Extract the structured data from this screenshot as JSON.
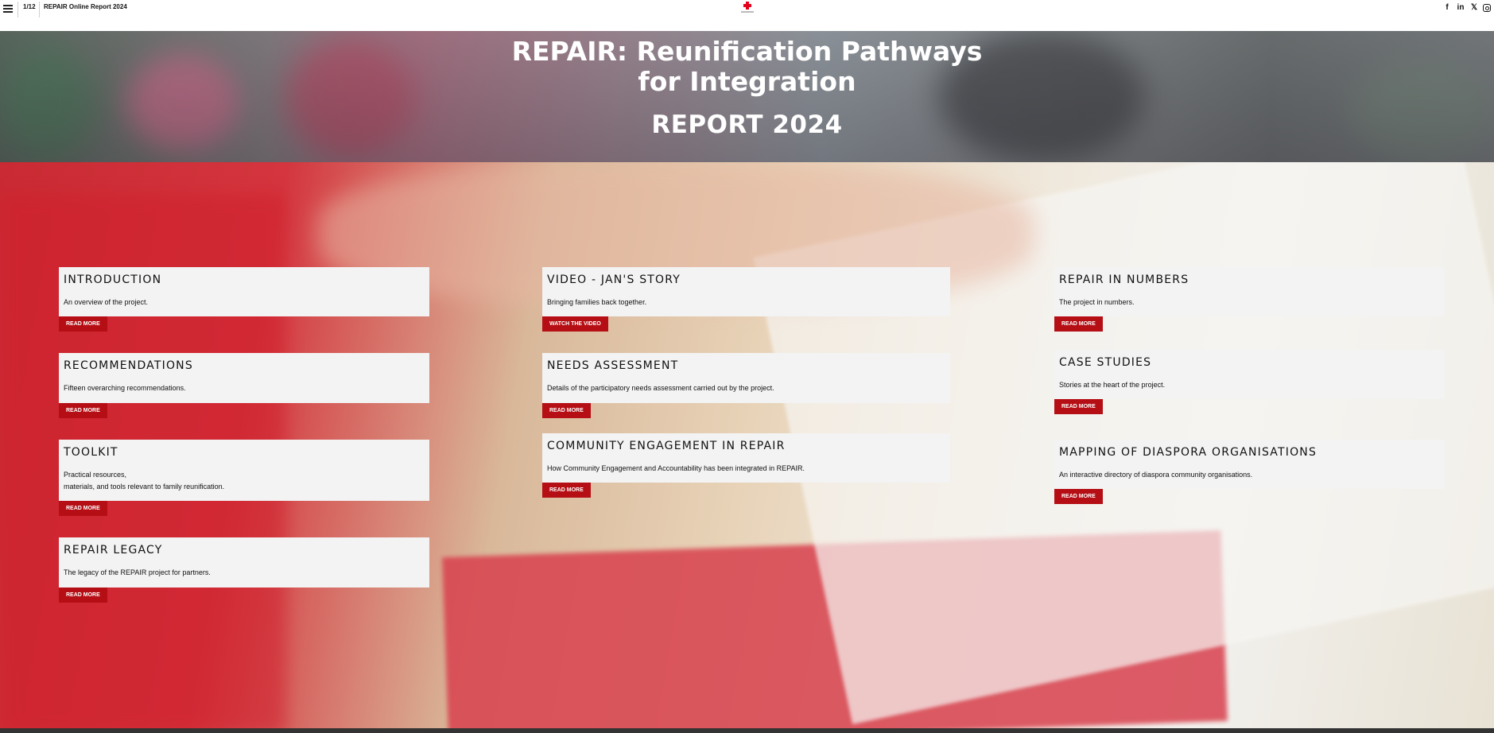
{
  "header": {
    "page_count": "1/12",
    "site_title": "REPAIR Online Report 2024",
    "social": [
      {
        "icon": "facebook-icon",
        "glyph": "f"
      },
      {
        "icon": "linkedin-icon",
        "glyph": "in"
      },
      {
        "icon": "x-icon",
        "glyph": "𝕏"
      },
      {
        "icon": "instagram-icon",
        "glyph": ""
      }
    ]
  },
  "hero": {
    "title_line1": "REPAIR: Reunification Pathways",
    "title_line2": "for Integration",
    "subtitle": "REPORT  2024"
  },
  "cards": {
    "introduction": {
      "title": "INTRODUCTION",
      "desc": "An overview of the project.",
      "button": "READ MORE"
    },
    "recommendations": {
      "title": "RECOMMENDATIONS",
      "desc": "Fifteen overarching recommendations.",
      "button": "READ MORE"
    },
    "toolkit": {
      "title": "TOOLKIT",
      "desc_line1": "Practical resources,",
      "desc_line2": "materials, and tools relevant to family reunification.",
      "button": "READ MORE"
    },
    "legacy": {
      "title": "REPAIR LEGACY",
      "desc": "The legacy of the REPAIR project for partners.",
      "button": "READ MORE"
    },
    "video": {
      "title": "VIDEO - JAN'S STORY",
      "desc": "Bringing families back together.",
      "button": "WATCH THE VIDEO"
    },
    "needs": {
      "title": "NEEDS ASSESSMENT",
      "desc": "Details of the participatory needs assessment carried out by the project.",
      "button": "READ MORE"
    },
    "community": {
      "title": "COMMUNITY ENGAGEMENT IN REPAIR",
      "desc": "How Community Engagement and Accountability has been integrated in REPAIR.",
      "button": "READ MORE"
    },
    "numbers": {
      "title": "REPAIR IN NUMBERS",
      "desc": "The project in numbers.",
      "button": "READ MORE"
    },
    "cases": {
      "title": "CASE STUDIES",
      "desc": "Stories at the heart of the project.",
      "button": "READ MORE"
    },
    "diaspora": {
      "title": "MAPPING OF DIASPORA ORGANISATIONS",
      "desc": "An interactive directory of diaspora community organisations.",
      "button": "READ MORE"
    }
  },
  "colors": {
    "accent": "#b50e14",
    "logo_red": "#e2001a"
  }
}
